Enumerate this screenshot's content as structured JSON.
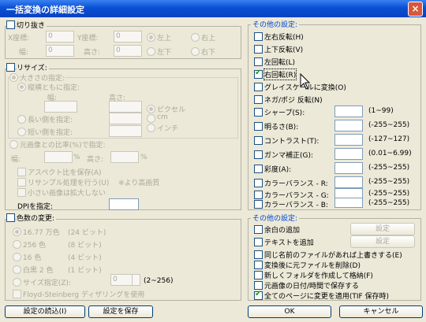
{
  "window": {
    "title": "一括変換の詳細設定",
    "close": "×"
  },
  "crop": {
    "group_label": "切り抜き",
    "x_label": "X座標:",
    "x_value": "0",
    "y_label": "Y座標:",
    "y_value": "0",
    "width_label": "幅:",
    "width_value": "0",
    "height_label": "高さ:",
    "height_value": "0",
    "top_left": "左上",
    "top_right": "右上",
    "bottom_left": "左下",
    "bottom_right": "右下"
  },
  "resize": {
    "group_label": "リサイズ:",
    "size_spec": "大きさの指定:",
    "both_spec": "縦横ともに指定:",
    "width": "幅:",
    "height": "高さ:",
    "pixel": "ピクセル",
    "cm": "cm",
    "inch": "インチ",
    "long_side": "長い側を指定:",
    "short_side": "短い側を指定:",
    "ratio": "元画像との比率(%)で指定:",
    "ratio_width": "幅:",
    "ratio_height": "高さ:",
    "percent": "%",
    "aspect": "アスペクト比を保存(A)",
    "resample": "リサンプル処理を行う(U)",
    "quality": "※より高画質",
    "enlarge": "小さい画像は拡大しない",
    "dpi_label": "DPIを指定:"
  },
  "colors": {
    "group_label": "色数の変更:",
    "c16m": "16.77 万色",
    "c16m_bits": "(24 ビット)",
    "c256": "256 色",
    "c256_bits": "(8 ビット)",
    "c16": "16 色",
    "c16_bits": "(4 ビット)",
    "c2": "白黒 2 色",
    "c2_bits": "(1 ビット)",
    "size_spec": "サイズ指定(Z):",
    "size_value": "0",
    "size_range": "(2~256)",
    "dither": "Floyd-Steinberg ディザリングを使用"
  },
  "other1": {
    "group_label": "その他の設定:",
    "flip_h": "左右反転(H)",
    "flip_v": "上下反転(V)",
    "rot_left": "左回転(L)",
    "rot_right": "右回転(R)",
    "gray": "グレイスケールに変換(O)",
    "nega": "ネガ/ポジ 反転(N)",
    "sharp": "シャープ(S):",
    "sharp_range": "(1~99)",
    "bright": "明るさ(B):",
    "bright_range": "(-255~255)",
    "contrast": "コントラスト(T):",
    "contrast_range": "(-127~127)",
    "gamma": "ガンマ補正(G):",
    "gamma_range": "(0.01~6.99)",
    "sat": "彩度(A):",
    "sat_range": "(-255~255)",
    "cb_r": "カラーバランス - R:",
    "cb_r_range": "(-255~255)",
    "cb_g": "カラーバランス - G:",
    "cb_g_range": "(-255~255)",
    "cb_b": "カラーバランス - B:",
    "cb_b_range": "(-255~255)"
  },
  "other2": {
    "group_label": "その他の設定:",
    "margin": "余白の追加",
    "margin_btn": "設定",
    "text": "テキストを追加",
    "text_btn": "設定",
    "overwrite": "同じ名前のファイルがあれば上書きする(E)",
    "delete": "変換後に元ファイルを削除(D)",
    "newfolder": "新しくフォルダを作成して格納(F)",
    "keepdate": "元画像の日付/時間で保存する",
    "allpages": "全てのページに変更を適用(TIF 保存時)"
  },
  "buttons": {
    "load": "設定の読込(I)",
    "save": "設定を保存",
    "ok": "OK",
    "cancel": "キャンセル"
  }
}
